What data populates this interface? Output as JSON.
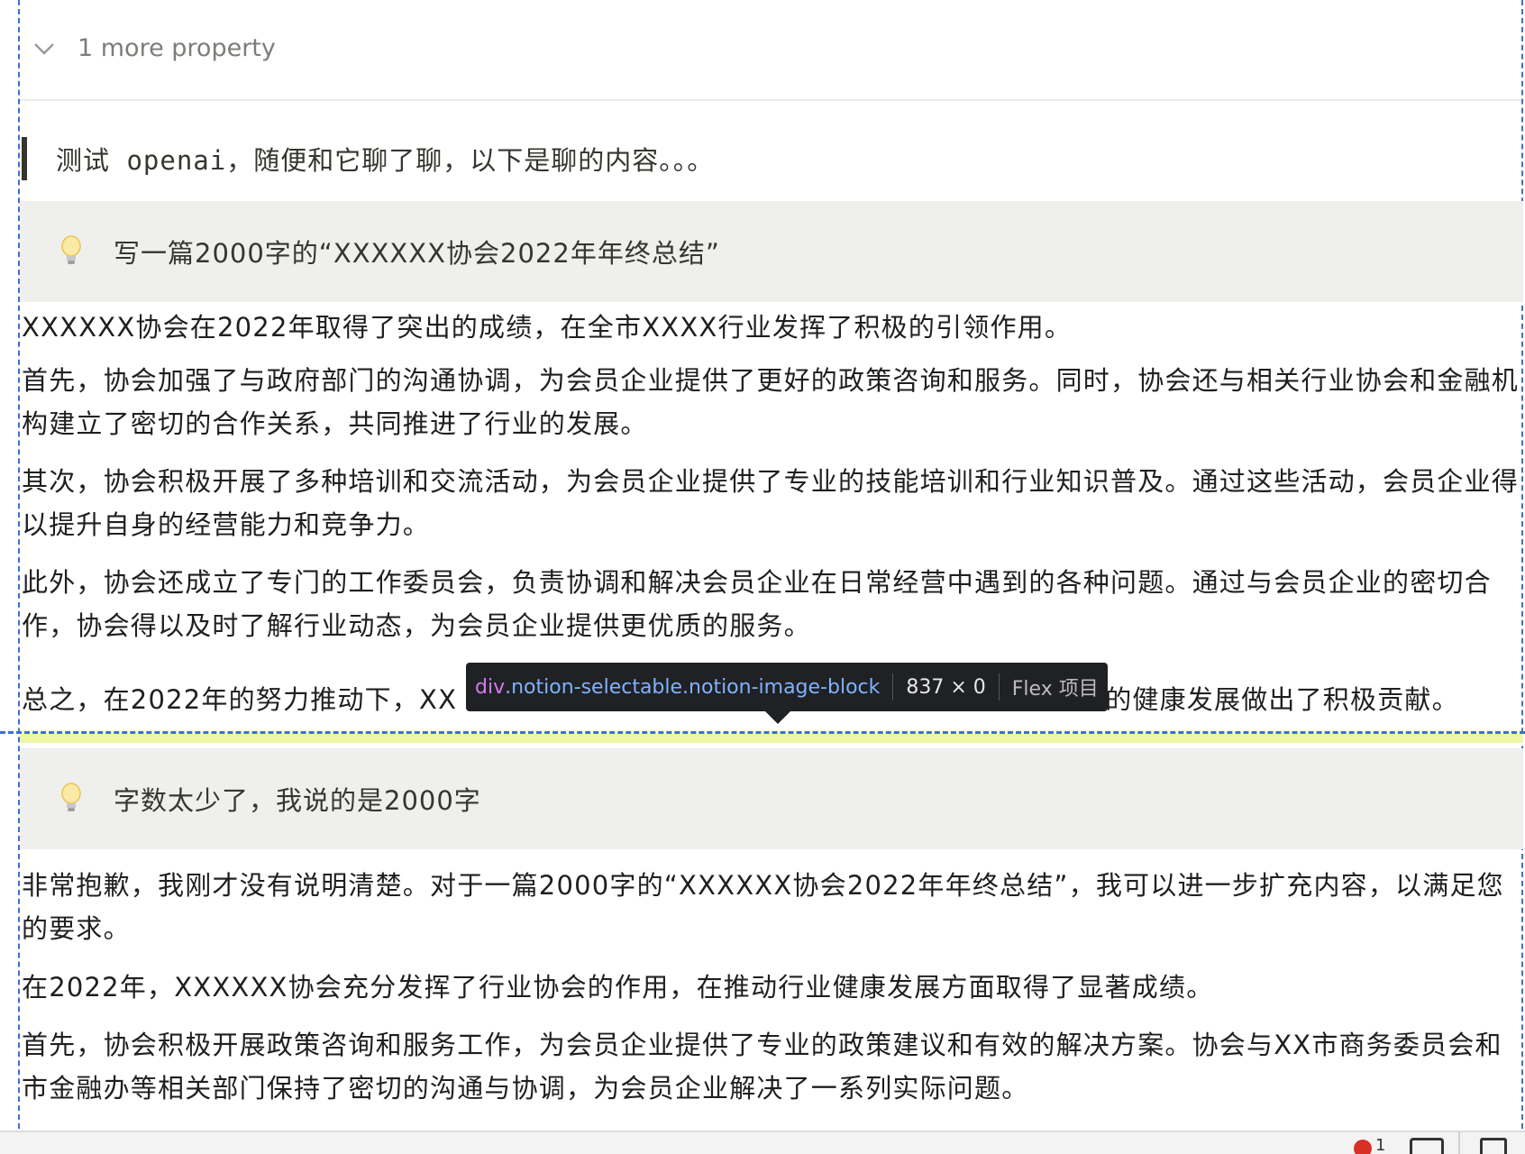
{
  "properties": {
    "more_label": "1 more property"
  },
  "quote": {
    "text": "测试 openai，随便和它聊了聊，以下是聊的内容。。。"
  },
  "callouts": [
    {
      "icon": "lightbulb-icon",
      "text": "写一篇2000字的“XXXXXX协会2022年年终总结”"
    },
    {
      "icon": "lightbulb-icon",
      "text": "字数太少了，我说的是2000字"
    }
  ],
  "answer1": {
    "paragraphs": [
      "XXXXXX协会在2022年取得了突出的成绩，在全市XXXX行业发挥了积极的引领作用。",
      "首先，协会加强了与政府部门的沟通协调，为会员企业提供了更好的政策咨询和服务。同时，协会还与相关行业协会和金融机构建立了密切的合作关系，共同推进了行业的发展。",
      "其次，协会积极开展了多种培训和交流活动，为会员企业提供了专业的技能培训和行业知识普及。通过这些活动，会员企业得以提升自身的经营能力和竞争力。",
      "此外，协会还成立了专门的工作委员会，负责协调和解决会员企业在日常经营中遇到的各种问题。通过与会员企业的密切合作，协会得以及时了解行业动态，为会员企业提供更优质的服务。"
    ],
    "last_visible_left": "总之，在2022年的努力推动下，XX",
    "last_visible_right": "业的健康发展做出了积极贡献。"
  },
  "answer2": {
    "paragraphs": [
      "非常抱歉，我刚才没有说明清楚。对于一篇2000字的“XXXXXX协会2022年年终总结”，我可以进一步扩充内容，以满足您的要求。",
      "在2022年，XXXXXX协会充分发挥了行业协会的作用，在推动行业健康发展方面取得了显著成绩。",
      "首先，协会积极开展政策咨询和服务工作，为会员企业提供了专业的政策建议和有效的解决方案。协会与XX市商务委员会和市金融办等相关部门保持了密切的沟通与协调，为会员企业解决了一系列实际问题。"
    ]
  },
  "devtools_tooltip": {
    "tag": "div",
    "classes": ".notion-selectable.notion-image-block",
    "dimensions": "837 × 0",
    "kind": "Flex 项目"
  },
  "statusbar": {
    "error_count": "1"
  },
  "colors": {
    "callout_bg": "#efefed",
    "guide": "#3b6fd6",
    "highlight": "#eef7a4",
    "tooltip_bg": "#202124",
    "tooltip_tag": "#d47aef",
    "tooltip_class": "#7fb2ff"
  }
}
